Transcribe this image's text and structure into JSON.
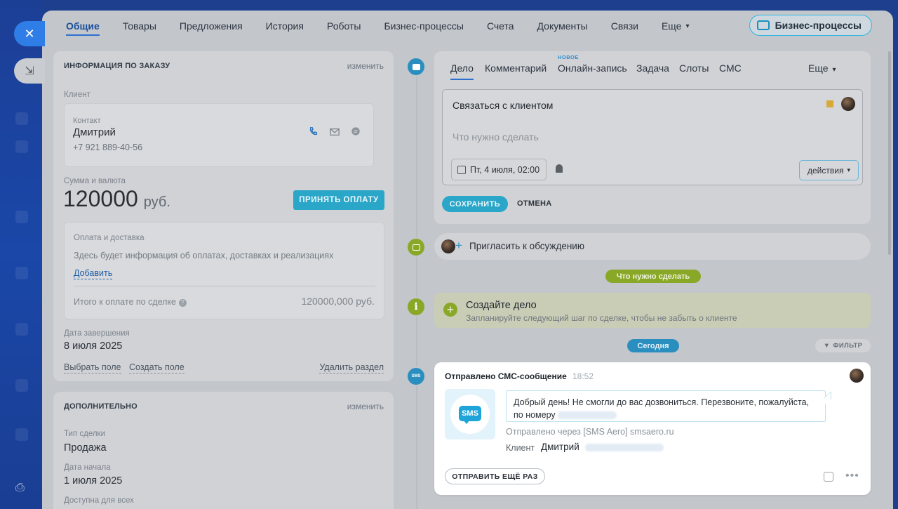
{
  "top_tabs": [
    {
      "label": "Общие"
    },
    {
      "label": "Товары"
    },
    {
      "label": "Предложения"
    },
    {
      "label": "История"
    },
    {
      "label": "Роботы"
    },
    {
      "label": "Бизнес-процессы"
    },
    {
      "label": "Счета"
    },
    {
      "label": "Документы"
    },
    {
      "label": "Связи"
    },
    {
      "label": "Еще"
    }
  ],
  "bp_button": "Бизнес-процессы",
  "order_info": {
    "title": "ИНФОРМАЦИЯ ПО ЗАКАЗУ",
    "edit": "изменить",
    "client_label": "Клиент",
    "contact_label": "Контакт",
    "contact_name": "Дмитрий",
    "contact_phone": "+7 921 889-40-56",
    "sum_label": "Сумма и валюта",
    "sum_value": "120000",
    "currency": "руб.",
    "pay_button": "ПРИНЯТЬ ОПЛАТУ",
    "payment_label": "Оплата и доставка",
    "payment_text": "Здесь будет информация об оплатах, доставках и реализациях",
    "add_link": "Добавить",
    "total_label": "Итого к оплате по сделке",
    "total_value": "120000,000 руб.",
    "end_date_label": "Дата завершения",
    "end_date_value": "8 июля 2025",
    "select_field": "Выбрать поле",
    "create_field": "Создать поле",
    "delete_section": "Удалить раздел"
  },
  "additional": {
    "title": "ДОПОЛНИТЕЛЬНО",
    "edit": "изменить",
    "deal_type_label": "Тип сделки",
    "deal_type_value": "Продажа",
    "start_date_label": "Дата начала",
    "start_date_value": "1 июля 2025",
    "available_label": "Доступна для всех"
  },
  "editor": {
    "tabs": [
      {
        "label": "Дело"
      },
      {
        "label": "Комментарий"
      },
      {
        "label": "Онлайн-запись"
      },
      {
        "label": "Задача"
      },
      {
        "label": "Слоты"
      },
      {
        "label": "СМС"
      }
    ],
    "new_badge": "НОВОЕ",
    "more": "Еще",
    "title": "Связаться с клиентом",
    "placeholder": "Что нужно сделать",
    "date": "Пт, 4 июля, 02:00",
    "actions": "действия",
    "save": "СОХРАНИТЬ",
    "cancel": "ОТМЕНА"
  },
  "invite": "Пригласить к обсуждению",
  "todo_pill": "Что нужно сделать",
  "todo": {
    "title": "Создайте дело",
    "subtitle": "Запланируйте следующий шаг по сделке, чтобы не забыть о клиенте"
  },
  "today_pill": "Сегодня",
  "filter": "ФИЛЬТР",
  "sms": {
    "header": "Отправлено СМС-сообщение",
    "time": "18:52",
    "logo_text": "SMS",
    "message_line1": "Добрый день! Не смогли до вас дозвониться. Перезвоните, пожалуйста,",
    "message_line2": "по номеру",
    "via": "Отправлено через [SMS Aero] smsaero.ru",
    "client_label": "Клиент",
    "client_name": "Дмитрий",
    "resend": "ОТПРАВИТЬ ЕЩЁ РАЗ"
  },
  "dot_labels": {
    "info": "i",
    "sms": "SMS"
  },
  "icons": {
    "close": "✕",
    "minimize": "⇲",
    "print": "⎙",
    "chevron": "⌄",
    "plus": "+",
    "more": "•••"
  },
  "colors": {
    "accent": "#2aa6c9",
    "green": "#8aa828",
    "link": "#2d6fcf"
  }
}
